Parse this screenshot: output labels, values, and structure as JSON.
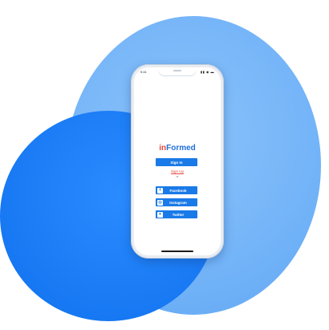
{
  "status": {
    "time": "9:41",
    "icons": "▮▮ ◉ ▬"
  },
  "app": {
    "logo_part1": "in",
    "logo_part2": "Formed",
    "signin_label": "Sign In",
    "signup_label": "Sign Up",
    "or_label": "or",
    "social": [
      {
        "icon": "facebook-icon",
        "glyph": "f",
        "label": "Facebook"
      },
      {
        "icon": "instagram-icon",
        "glyph": "◎",
        "label": "Instagram"
      },
      {
        "icon": "twitter-icon",
        "glyph": "✦",
        "label": "Twitter"
      }
    ]
  },
  "colors": {
    "accent": "#1a7ae8",
    "logo_red": "#e8473c",
    "logo_blue": "#1e6fd9",
    "blob_light": "#6fb1f7",
    "blob_dark": "#1677f2"
  }
}
